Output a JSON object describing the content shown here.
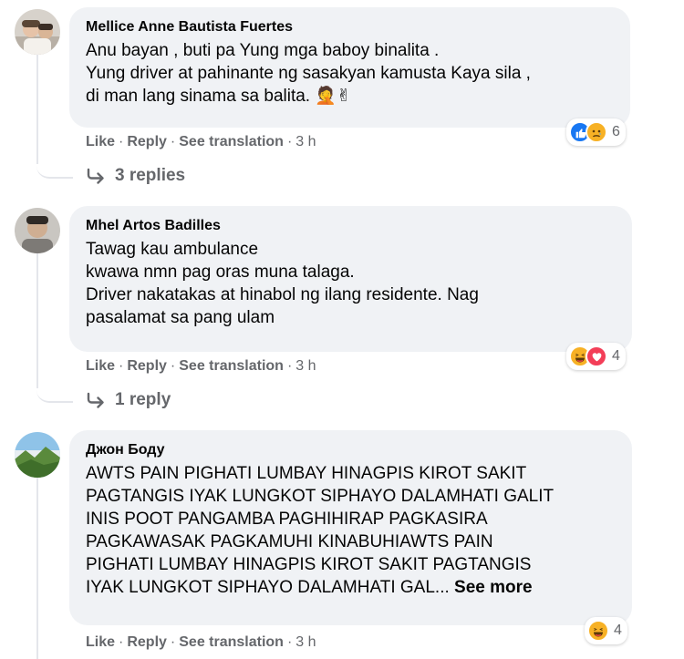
{
  "comments": [
    {
      "author": "Mellice Anne Bautista Fuertes",
      "text": "Anu bayan , buti pa Yung mga baboy binalita .\nYung driver at pahinante ng sasakyan kamusta Kaya sila ,\ndi man lang sinama sa balita.",
      "emoji": "🤦✌",
      "actions": {
        "like": "Like",
        "reply": "Reply",
        "translate": "See translation",
        "time": "3 h"
      },
      "reaction_icons": [
        "like-icon",
        "sad-icon"
      ],
      "reaction_count": "6",
      "replies": "3 replies"
    },
    {
      "author": "Mhel Artos Badilles",
      "text": "Tawag kau ambulance\nkwawa nmn pag oras muna talaga.\nDriver nakatakas at hinabol ng ilang residente. Nag\npasalamat sa pang ulam",
      "actions": {
        "like": "Like",
        "reply": "Reply",
        "translate": "See translation",
        "time": "3 h"
      },
      "reaction_icons": [
        "haha-icon",
        "love-icon"
      ],
      "reaction_count": "4",
      "replies": "1 reply"
    },
    {
      "author": "Джон Боду",
      "text": "AWTS PAIN PIGHATI LUMBAY HINAGPIS KIROT SAKIT\nPAGTANGIS IYAK LUNGKOT SIPHAYO DALAMHATI GALIT\nINIS POOT PANGAMBA PAGHIHIRAP PAGKASIRA\nPAGKAWASAK PAGKAMUHI KINABUHIAWTS PAIN\nPIGHATI LUMBAY HINAGPIS KIROT SAKIT PAGTANGIS\nIYAK LUNGKOT SIPHAYO DALAMHATI GAL...",
      "see_more": "See more",
      "actions": {
        "like": "Like",
        "reply": "Reply",
        "translate": "See translation",
        "time": "3 h"
      },
      "reaction_icons": [
        "haha-icon"
      ],
      "reaction_count": "4"
    }
  ],
  "colors": {
    "bubble": "#f0f2f5",
    "meta": "#65676b",
    "like_blue": "#1877f2",
    "love_red": "#f33e58",
    "haha_yellow": "#f7b125"
  },
  "separator": "·"
}
